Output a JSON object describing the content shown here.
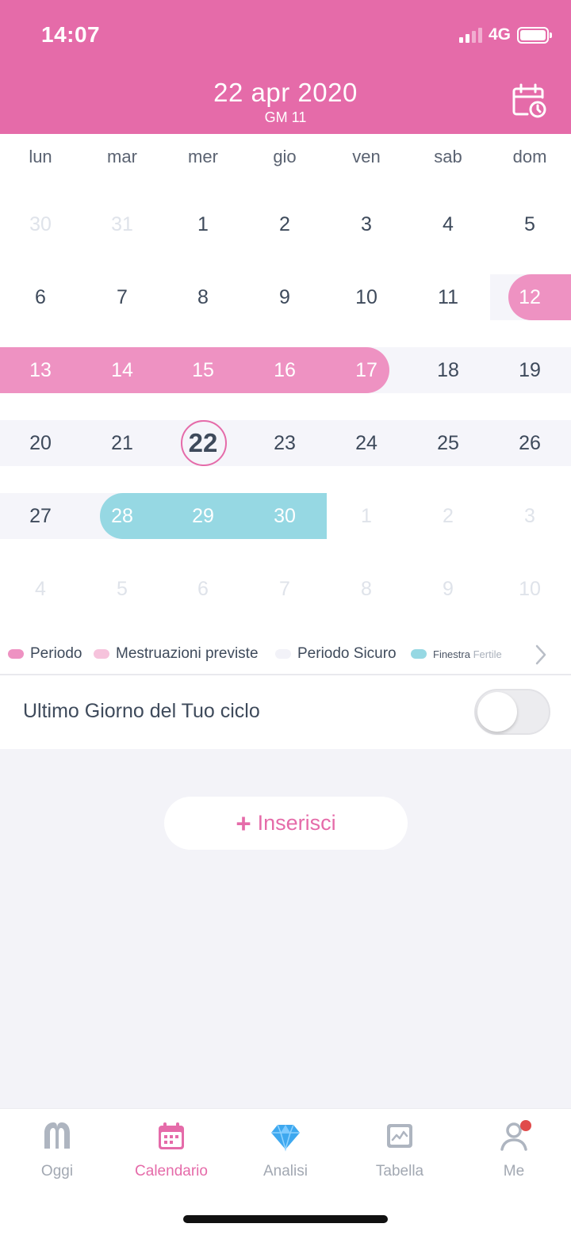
{
  "status": {
    "time": "14:07",
    "network": "4G"
  },
  "header": {
    "date": "22 apr 2020",
    "subtitle": "GM 11"
  },
  "calendar": {
    "weekdays": [
      "lun",
      "mar",
      "mer",
      "gio",
      "ven",
      "sab",
      "dom"
    ],
    "weeks": [
      [
        "30",
        "31",
        "1",
        "2",
        "3",
        "4",
        "5"
      ],
      [
        "6",
        "7",
        "8",
        "9",
        "10",
        "11",
        "12"
      ],
      [
        "13",
        "14",
        "15",
        "16",
        "17",
        "18",
        "19"
      ],
      [
        "20",
        "21",
        "22",
        "23",
        "24",
        "25",
        "26"
      ],
      [
        "27",
        "28",
        "29",
        "30",
        "1",
        "2",
        "3"
      ],
      [
        "4",
        "5",
        "6",
        "7",
        "8",
        "9",
        "10"
      ]
    ],
    "today": "22"
  },
  "legend": {
    "period": "Periodo",
    "predicted": "Mestruazioni previste",
    "safe": "Periodo Sicuro",
    "fertile_a": "Finestra",
    "fertile_b": "Fertile"
  },
  "toggle": {
    "label": "Ultimo Giorno del Tuo ciclo",
    "on": false
  },
  "insert": {
    "plus": "+",
    "label": "Inserisci"
  },
  "tabs": [
    "Oggi",
    "Calendario",
    "Analisi",
    "Tabella",
    "Me"
  ],
  "colors": {
    "brand": "#e56ba9",
    "period": "#ee92c2",
    "predicted": "#f6c3dc",
    "safe": "#f5f5fa",
    "fertile": "#96d8e3"
  }
}
